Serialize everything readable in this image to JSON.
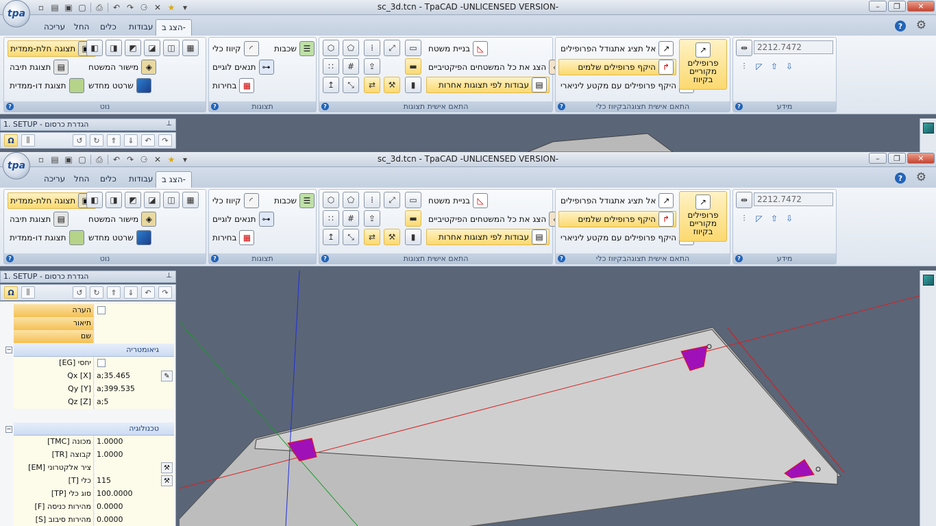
{
  "app": {
    "title": "sc_3d.tcn - TpaCAD -UNLICENSED VERSION-",
    "logo_text": "tpa"
  },
  "tabs": [
    "עריכה",
    "החל",
    "כלים",
    "עבודות",
    "הצג ב-"
  ],
  "active_tab": 4,
  "ribbon": {
    "view_group": {
      "title": "נוט",
      "btn_partial": "תצוגה חלת-ממדית",
      "btn_box": "תצוגת תיבה",
      "btn_2d": "תצוגת דו-ממדית",
      "btn_plane": "מישור המשטח",
      "btn_redraw": "שרטט מחדש"
    },
    "display_group": {
      "title": "תצוגות",
      "btn_layers": "שכבות",
      "btn_tool_path": "קיווז כלי",
      "btn_logic": "תנאים לוגיים",
      "btn_selections": "בחירות"
    },
    "custom_group": {
      "title": "התאם אישית תצוגות",
      "btn_build_face": "בניית משטח",
      "btn_show_faces": "הצג את כל המשטחים הפיקטיביים",
      "btn_work_views": "עבודות לפי תצוגות אחרות"
    },
    "tool_group": {
      "title": "התאם אישית תצוגהבקיווז כלי",
      "btn_dont_show_size": "אל תציג אתגודל הפרופילים",
      "btn_full_profiles": "היקף פרופילים שלמים",
      "btn_linear_profiles": "היקף פרופילים עם מקטע ליניארי",
      "btn_original_profiles": "פרופילים מקוריים בקיווז"
    },
    "info_group": {
      "title": "מידע",
      "value": "2212.7472"
    }
  },
  "panel": {
    "header": "1. SETUP - הגדרת כרסום"
  },
  "properties": {
    "rows": [
      {
        "label": "הערה",
        "value": ""
      },
      {
        "label": "תיאור",
        "value": ""
      },
      {
        "label": "שם",
        "value": ""
      }
    ],
    "geometry_header": "גיאומטריה",
    "geometry": [
      {
        "label": "יחסי [EG]",
        "value": ""
      },
      {
        "label": "Qx [X]",
        "value": "a;35.465"
      },
      {
        "label": "Qy [Y]",
        "value": "a;399.535"
      },
      {
        "label": "Qz [Z]",
        "value": "a;5"
      }
    ],
    "tech_header": "טכנולוגיה",
    "technology": [
      {
        "label": "מכונה [TMC]",
        "value": "1.0000"
      },
      {
        "label": "קבוצה [TR]",
        "value": "1.0000"
      },
      {
        "label": "ציר אלקטרוני [EM]",
        "value": ""
      },
      {
        "label": "כלי [T]",
        "value": "115"
      },
      {
        "label": "סוג כלי [TP]",
        "value": "100.0000"
      },
      {
        "label": "מהירות כניסה [F]",
        "value": "0.0000"
      },
      {
        "label": "מהירות סיבוב [S]",
        "value": "0.0000"
      }
    ]
  },
  "colors": {
    "viewport_bg": "#5a6577",
    "accent": "#fbd96f",
    "axis_x": "#d62020",
    "axis_y": "#1d9a2a",
    "axis_z": "#2030d8",
    "marker": "#a010b8"
  }
}
